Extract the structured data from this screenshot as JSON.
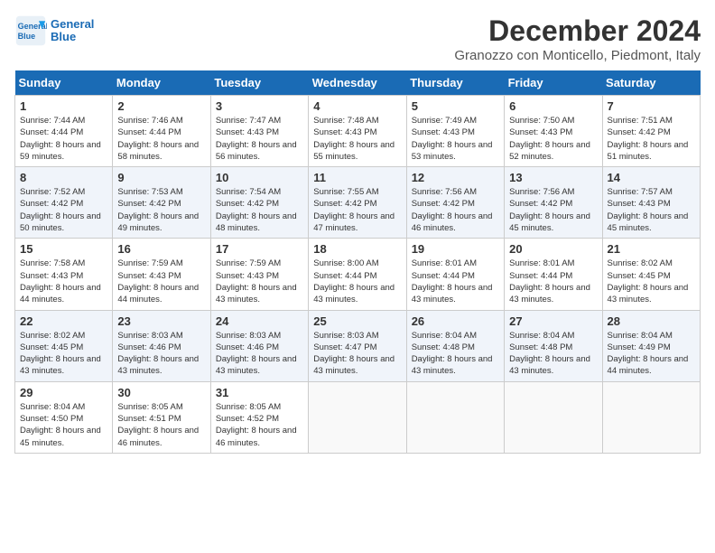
{
  "header": {
    "logo_line1": "General",
    "logo_line2": "Blue",
    "month": "December 2024",
    "location": "Granozzo con Monticello, Piedmont, Italy"
  },
  "weekdays": [
    "Sunday",
    "Monday",
    "Tuesday",
    "Wednesday",
    "Thursday",
    "Friday",
    "Saturday"
  ],
  "weeks": [
    [
      {
        "day": "1",
        "sunrise": "Sunrise: 7:44 AM",
        "sunset": "Sunset: 4:44 PM",
        "daylight": "Daylight: 8 hours and 59 minutes."
      },
      {
        "day": "2",
        "sunrise": "Sunrise: 7:46 AM",
        "sunset": "Sunset: 4:44 PM",
        "daylight": "Daylight: 8 hours and 58 minutes."
      },
      {
        "day": "3",
        "sunrise": "Sunrise: 7:47 AM",
        "sunset": "Sunset: 4:43 PM",
        "daylight": "Daylight: 8 hours and 56 minutes."
      },
      {
        "day": "4",
        "sunrise": "Sunrise: 7:48 AM",
        "sunset": "Sunset: 4:43 PM",
        "daylight": "Daylight: 8 hours and 55 minutes."
      },
      {
        "day": "5",
        "sunrise": "Sunrise: 7:49 AM",
        "sunset": "Sunset: 4:43 PM",
        "daylight": "Daylight: 8 hours and 53 minutes."
      },
      {
        "day": "6",
        "sunrise": "Sunrise: 7:50 AM",
        "sunset": "Sunset: 4:43 PM",
        "daylight": "Daylight: 8 hours and 52 minutes."
      },
      {
        "day": "7",
        "sunrise": "Sunrise: 7:51 AM",
        "sunset": "Sunset: 4:42 PM",
        "daylight": "Daylight: 8 hours and 51 minutes."
      }
    ],
    [
      {
        "day": "8",
        "sunrise": "Sunrise: 7:52 AM",
        "sunset": "Sunset: 4:42 PM",
        "daylight": "Daylight: 8 hours and 50 minutes."
      },
      {
        "day": "9",
        "sunrise": "Sunrise: 7:53 AM",
        "sunset": "Sunset: 4:42 PM",
        "daylight": "Daylight: 8 hours and 49 minutes."
      },
      {
        "day": "10",
        "sunrise": "Sunrise: 7:54 AM",
        "sunset": "Sunset: 4:42 PM",
        "daylight": "Daylight: 8 hours and 48 minutes."
      },
      {
        "day": "11",
        "sunrise": "Sunrise: 7:55 AM",
        "sunset": "Sunset: 4:42 PM",
        "daylight": "Daylight: 8 hours and 47 minutes."
      },
      {
        "day": "12",
        "sunrise": "Sunrise: 7:56 AM",
        "sunset": "Sunset: 4:42 PM",
        "daylight": "Daylight: 8 hours and 46 minutes."
      },
      {
        "day": "13",
        "sunrise": "Sunrise: 7:56 AM",
        "sunset": "Sunset: 4:42 PM",
        "daylight": "Daylight: 8 hours and 45 minutes."
      },
      {
        "day": "14",
        "sunrise": "Sunrise: 7:57 AM",
        "sunset": "Sunset: 4:43 PM",
        "daylight": "Daylight: 8 hours and 45 minutes."
      }
    ],
    [
      {
        "day": "15",
        "sunrise": "Sunrise: 7:58 AM",
        "sunset": "Sunset: 4:43 PM",
        "daylight": "Daylight: 8 hours and 44 minutes."
      },
      {
        "day": "16",
        "sunrise": "Sunrise: 7:59 AM",
        "sunset": "Sunset: 4:43 PM",
        "daylight": "Daylight: 8 hours and 44 minutes."
      },
      {
        "day": "17",
        "sunrise": "Sunrise: 7:59 AM",
        "sunset": "Sunset: 4:43 PM",
        "daylight": "Daylight: 8 hours and 43 minutes."
      },
      {
        "day": "18",
        "sunrise": "Sunrise: 8:00 AM",
        "sunset": "Sunset: 4:44 PM",
        "daylight": "Daylight: 8 hours and 43 minutes."
      },
      {
        "day": "19",
        "sunrise": "Sunrise: 8:01 AM",
        "sunset": "Sunset: 4:44 PM",
        "daylight": "Daylight: 8 hours and 43 minutes."
      },
      {
        "day": "20",
        "sunrise": "Sunrise: 8:01 AM",
        "sunset": "Sunset: 4:44 PM",
        "daylight": "Daylight: 8 hours and 43 minutes."
      },
      {
        "day": "21",
        "sunrise": "Sunrise: 8:02 AM",
        "sunset": "Sunset: 4:45 PM",
        "daylight": "Daylight: 8 hours and 43 minutes."
      }
    ],
    [
      {
        "day": "22",
        "sunrise": "Sunrise: 8:02 AM",
        "sunset": "Sunset: 4:45 PM",
        "daylight": "Daylight: 8 hours and 43 minutes."
      },
      {
        "day": "23",
        "sunrise": "Sunrise: 8:03 AM",
        "sunset": "Sunset: 4:46 PM",
        "daylight": "Daylight: 8 hours and 43 minutes."
      },
      {
        "day": "24",
        "sunrise": "Sunrise: 8:03 AM",
        "sunset": "Sunset: 4:46 PM",
        "daylight": "Daylight: 8 hours and 43 minutes."
      },
      {
        "day": "25",
        "sunrise": "Sunrise: 8:03 AM",
        "sunset": "Sunset: 4:47 PM",
        "daylight": "Daylight: 8 hours and 43 minutes."
      },
      {
        "day": "26",
        "sunrise": "Sunrise: 8:04 AM",
        "sunset": "Sunset: 4:48 PM",
        "daylight": "Daylight: 8 hours and 43 minutes."
      },
      {
        "day": "27",
        "sunrise": "Sunrise: 8:04 AM",
        "sunset": "Sunset: 4:48 PM",
        "daylight": "Daylight: 8 hours and 43 minutes."
      },
      {
        "day": "28",
        "sunrise": "Sunrise: 8:04 AM",
        "sunset": "Sunset: 4:49 PM",
        "daylight": "Daylight: 8 hours and 44 minutes."
      }
    ],
    [
      {
        "day": "29",
        "sunrise": "Sunrise: 8:04 AM",
        "sunset": "Sunset: 4:50 PM",
        "daylight": "Daylight: 8 hours and 45 minutes."
      },
      {
        "day": "30",
        "sunrise": "Sunrise: 8:05 AM",
        "sunset": "Sunset: 4:51 PM",
        "daylight": "Daylight: 8 hours and 46 minutes."
      },
      {
        "day": "31",
        "sunrise": "Sunrise: 8:05 AM",
        "sunset": "Sunset: 4:52 PM",
        "daylight": "Daylight: 8 hours and 46 minutes."
      },
      null,
      null,
      null,
      null
    ]
  ]
}
